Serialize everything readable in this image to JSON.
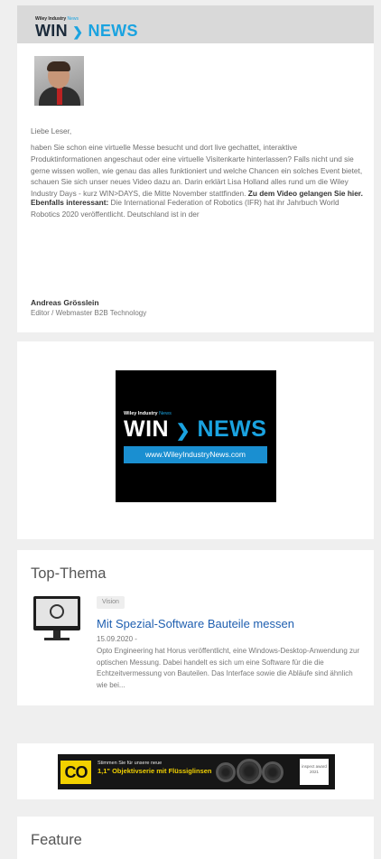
{
  "brand": {
    "small": "Wiley Industry",
    "small_tag": "News",
    "win": "WIN",
    "chevron": "❯",
    "news": "NEWS"
  },
  "newsletter": {
    "greeting": "Liebe Leser,",
    "body_text": "haben Sie schon eine virtuelle Messe besucht und dort live gechattet, interaktive Produktinformationen angeschaut oder eine virtuelle Visitenkarte hinterlassen? Falls nicht und sie gerne wissen wollen, wie genau das alles funktioniert und welche Chancen ein solches Event bietet, schauen Sie sich unser neues Video dazu an. Darin erklärt Lisa Holland alles rund um die Wiley Industry Days - kurz WIN>DAYS, die Mitte November stattfinden.",
    "body_link": "Zu dem Video gelangen Sie hier.",
    "more_label": "Ebenfalls interessant:",
    "more_text": "Die International Federation of Robotics (IFR) hat ihr Jahrbuch World Robotics 2020 veröffentlicht. Deutschland ist in der",
    "sign_name": "Andreas Grösslein",
    "sign_role": "Editor / Webmaster B2B Technology"
  },
  "banner": {
    "url": "www.WileyIndustryNews.com"
  },
  "top_thema": {
    "title": "Top-Thema",
    "tag": "Vision",
    "article_title": "Mit Spezial-Software Bauteile messen",
    "date": "15.09.2020 -",
    "description": "Opto Engineering hat Horus veröffentlicht, eine Windows-Desktop-Anwendung zur optischen Messung. Dabei handelt es sich um eine Software für die die Echtzeitvermessung von Bauteilen. Das Interface sowie die Abläufe sind ähnlich wie bei..."
  },
  "ad": {
    "logo": "CO",
    "line1": "Stimmen Sie für unsere neue",
    "line2": "1,1\" Objektivserie mit Flüssiglinsen",
    "badge": "inspect award 2021"
  },
  "feature": {
    "title": "Feature"
  },
  "colors": {
    "accent": "#1aa3e0",
    "link": "#1f5fb0",
    "header_bg": "#d9d9d9",
    "page_bg": "#efefef"
  }
}
